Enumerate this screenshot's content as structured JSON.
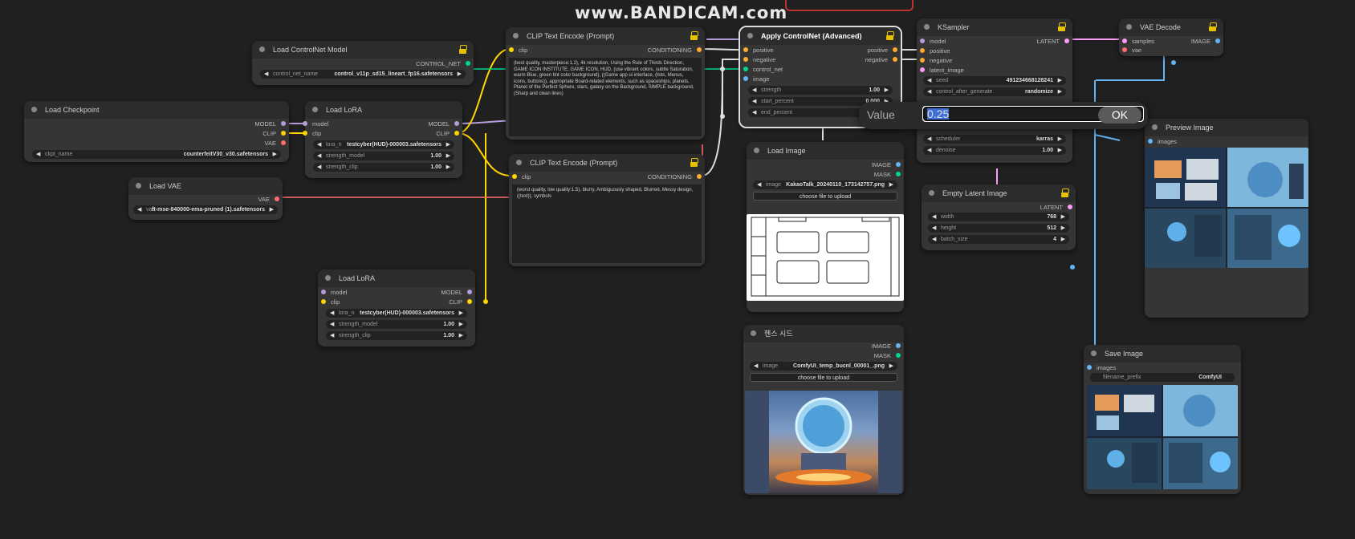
{
  "watermark": "www.BANDICAM.com",
  "nodes": {
    "load_controlnet": {
      "title": "Load ControlNet Model",
      "out": "CONTROL_NET",
      "w_label": "control_net_name",
      "w_value": "control_v11p_sd15_lineart_fp16.safetensors"
    },
    "load_checkpoint": {
      "title": "Load Checkpoint",
      "out_model": "MODEL",
      "out_clip": "CLIP",
      "out_vae": "VAE",
      "w_label": "ckpt_name",
      "w_value": "counterfeitV30_v30.safetensors"
    },
    "load_lora_1": {
      "title": "Load LoRA",
      "in_model": "model",
      "in_clip": "clip",
      "out_model": "MODEL",
      "out_clip": "CLIP",
      "w1_label": "lora_n",
      "w1_value": "testcyber(HUD)-000003.safetensors",
      "w2_label": "strength_model",
      "w2_value": "1.00",
      "w3_label": "strength_clip",
      "w3_value": "1.00"
    },
    "load_vae": {
      "title": "Load VAE",
      "out": "VAE",
      "w_label": "vae",
      "w_value": "ft-mse-840000-ema-pruned (1).safetensors"
    },
    "load_lora_2": {
      "title": "Load LoRA",
      "in_model": "model",
      "in_clip": "clip",
      "out_model": "MODEL",
      "out_clip": "CLIP",
      "w1_label": "lora_n",
      "w1_value": "testcyber(HUD)-000003.safetensors",
      "w2_label": "strength_model",
      "w2_value": "1.00",
      "w3_label": "strength_clip",
      "w3_value": "1.00"
    },
    "clip_pos": {
      "title": "CLIP Text Encode (Prompt)",
      "in": "clip",
      "out": "CONDITIONING",
      "text": "(best quality, masterpiece:1.2), 4k resolution, Using the Rule of Thirds Direction, GAME ICON INSTITUTE, GAME ICON, HUD, (use vibrant colors, subtle Saturation, warm Blue, green tint color background), ((Game app ui interface, (lists, Menus, icons, buttons)), appropriate Board-related elements, such as spaceships, planets, Planet of the Perfect Sphere, stars, galaxy on the Background, SIMPLE background, (Sharp and clean lines)"
    },
    "clip_neg": {
      "title": "CLIP Text Encode (Prompt)",
      "in": "clip",
      "out": "CONDITIONING",
      "text": "(worst quality, low quality:1.5), blurry, Ambiguously shaped, Blurred, Messy design, ((text)), symbols"
    },
    "apply_controlnet": {
      "title": "Apply ControlNet (Advanced)",
      "in1": "positive",
      "in2": "negative",
      "in3": "control_net",
      "in4": "image",
      "out1": "positive",
      "out2": "negative",
      "w1_label": "strength",
      "w1_value": "1.00",
      "w2_label": "start_percent",
      "w2_value": "0.000",
      "w3_label": "end_percent",
      "w3_value": ""
    },
    "load_image": {
      "title": "Load Image",
      "out1": "IMAGE",
      "out2": "MASK",
      "w_label": "image",
      "w_value": "KakaoTalk_20240110_173142757.png",
      "btn": "choose file to upload"
    },
    "load_image_2": {
      "title": "헨스 시드",
      "out1": "IMAGE",
      "out2": "MASK",
      "w_label": "image",
      "w_value": "ComfyUI_temp_bucnl_00001_.png",
      "btn": "choose file to upload"
    },
    "ksampler": {
      "title": "KSampler",
      "in1": "model",
      "in2": "positive",
      "in3": "negative",
      "in4": "latent_image",
      "out": "LATENT",
      "seed_label": "seed",
      "seed_value": "491234668128241",
      "ctrl_label": "control_after_generate",
      "ctrl_value": "randomize",
      "sched_label": "scheduler",
      "sched_value": "karras",
      "denoise_label": "denoise",
      "denoise_value": "1.00"
    },
    "empty_latent": {
      "title": "Empty Latent Image",
      "out": "LATENT",
      "w1_label": "width",
      "w1_value": "768",
      "w2_label": "height",
      "w2_value": "512",
      "w3_label": "batch_size",
      "w3_value": "4"
    },
    "vae_decode": {
      "title": "VAE Decode",
      "in1": "samples",
      "in2": "vae",
      "out": "IMAGE"
    },
    "preview_image": {
      "title": "Preview Image",
      "in": "images"
    },
    "save_image": {
      "title": "Save Image",
      "in": "images",
      "w_label": "filename_prefix",
      "w_value": "ComfyUI"
    }
  },
  "dialog": {
    "label": "Value",
    "value": "0.25",
    "ok": "OK"
  },
  "colors": {
    "model": "#b39ddb",
    "clip": "#ffd500",
    "vae": "#ff6e6e",
    "conditioning": "#ffa931",
    "latent": "#ff9cf9",
    "image": "#64b5f6",
    "control": "#00d78d"
  }
}
